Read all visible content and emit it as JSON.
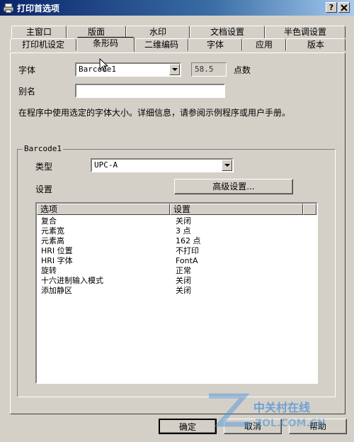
{
  "window": {
    "title": "打印首选项",
    "help_button": "?",
    "close_button": "X"
  },
  "tabs": {
    "row_back": [
      "主窗口",
      "版面",
      "水印",
      "文档设置",
      "半色调设置"
    ],
    "row_front": [
      "打印机设定",
      "条形码",
      "二维编码",
      "字体",
      "应用",
      "版本"
    ],
    "active": "条形码"
  },
  "font_row": {
    "label": "字体",
    "value": "Barcode1",
    "size_value": "58.5",
    "size_unit": "点数"
  },
  "alias_row": {
    "label": "别名",
    "value": ""
  },
  "info_text": "在程序中使用选定的字体大小。详细信息，请参阅示例程序或用户手册。",
  "group": {
    "label": "Barcode1",
    "type_label": "类型",
    "type_value": "UPC-A",
    "settings_label": "设置",
    "advanced_button": "高级设置..."
  },
  "listview": {
    "columns": [
      "选项",
      "设置"
    ],
    "rows": [
      {
        "option": "复合",
        "setting": "关闭"
      },
      {
        "option": "元素宽",
        "setting": "3 点"
      },
      {
        "option": "元素高",
        "setting": "162 点"
      },
      {
        "option": "HRI 位置",
        "setting": "不打印"
      },
      {
        "option": "HRI 字体",
        "setting": "FontA"
      },
      {
        "option": "旋转",
        "setting": "正常"
      },
      {
        "option": "十六进制输入模式",
        "setting": "关闭"
      },
      {
        "option": "添加静区",
        "setting": "关闭"
      }
    ]
  },
  "footer": {
    "ok": "确定",
    "cancel": "取消",
    "help": "帮助"
  },
  "watermark": {
    "text": "中关村在线",
    "sub": "ZOL.COM.CN"
  },
  "colors": {
    "titlebar_start": "#0a246a",
    "titlebar_end": "#a6caf0",
    "window_bg": "#d4d0c8"
  }
}
